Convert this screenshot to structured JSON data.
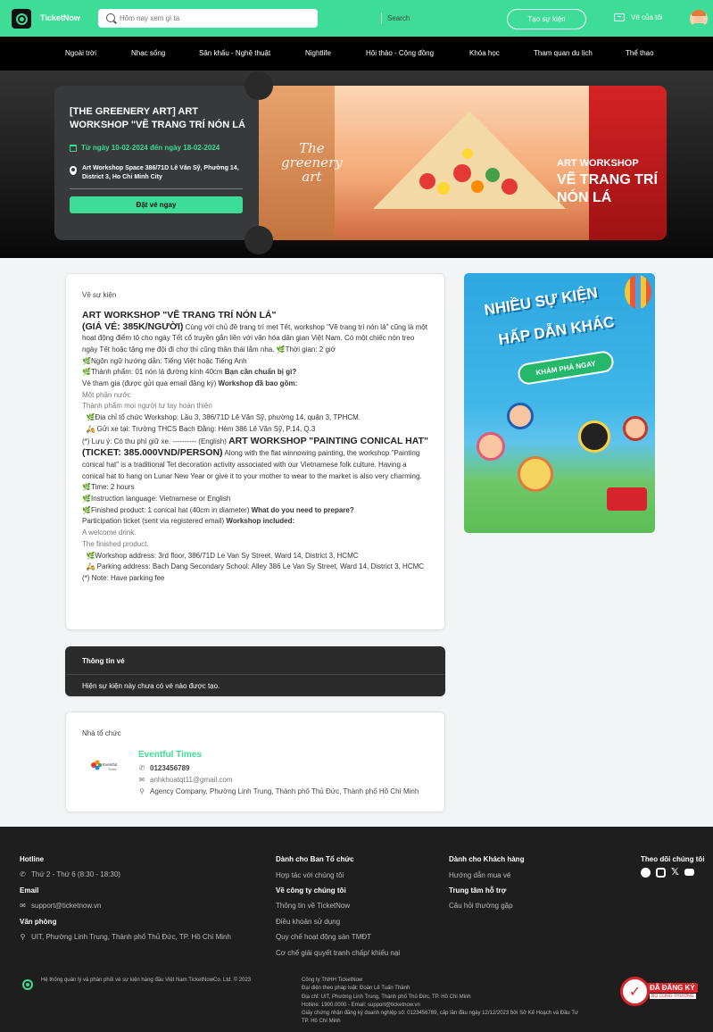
{
  "header": {
    "brand": "TicketNow",
    "search_placeholder": "Hôm nay xem gì ta",
    "search_button": "Search",
    "create_event": "Tạo sự kiện",
    "my_tickets": "Vé của tôi"
  },
  "nav": {
    "items": [
      "Ngoài trời",
      "Nhạc sống",
      "Sân khấu - Nghệ thuật",
      "Nightlife",
      "Hội thảo - Cộng đồng",
      "Khóa học",
      "Tham quan du lịch",
      "Thể thao"
    ]
  },
  "hero": {
    "title": "[THE GREENERY ART] ART WORKSHOP \"VẼ TRANG TRÍ NÓN LÁ",
    "date": "Từ ngày 10-02-2024 đến ngày 18-02-2024",
    "address": "Art Workshop Space 386/71D Lê Văn Sỹ, Phường 14, District 3, Ho Chi Minh City",
    "book_button": "Đặt vé ngay",
    "image_text": {
      "greenery_line1": "The",
      "greenery_line2": "greenery",
      "greenery_line3": "art",
      "aw_small": "ART WORKSHOP",
      "aw_big": "VẼ TRANG TRÍ NÓN LÁ"
    }
  },
  "about": {
    "label": "Về sự kiện",
    "vi_title": "ART WORKSHOP \"VẼ TRANG TRÍ NÓN LÁ\"",
    "vi_price": "(GIÁ VÉ: 385K/NGƯỜI)",
    "vi_intro": " Cùng với chủ đề trang trí mẹt Tết, workshop \"Vẽ trang trí nón lá\" cũng là một hoạt động điểm tô cho ngày Tết cổ truyền gắn liền với văn hóa dân gian Việt Nam. Có một chiếc nón treo ngày Tết hoặc tặng mẹ đội đi chợ thì cũng thần thái lắm nha. ",
    "vi_time": "Thời gian: 2 giờ",
    "vi_lang": "Ngôn ngữ hướng dẫn: Tiếng Việt hoặc Tiếng Anh",
    "vi_product": "Thành phẩm: 01 nón lá đường kính 40cm ",
    "vi_prepare": "Bạn cần chuẩn bị gì?",
    "vi_ticket": "Vé tham gia (được gửi qua email đăng ký) ",
    "vi_includes": "Workshop đã bao gồm:",
    "vi_drink": "Một phần nước",
    "vi_finished": "Thành phẩm mọi người tự tay hoàn thiện",
    "vi_address": "Địa chỉ tổ chức Workshop: Lầu 3, 386/71D Lê Văn Sỹ, phường 14, quận 3, TPHCM.",
    "vi_parking": "Gửi xe tại: Trường THCS Bạch Đằng: Hẻm 386 Lê Văn Sỹ, P.14, Q.3",
    "vi_note": "(*) Lưu ý: Có thu phí giữ xe. ---------- (English) ",
    "en_title": "ART WORKSHOP \"PAINTING CONICAL HAT\"",
    "en_price": "(TICKET: 385.000VND/PERSON)",
    "en_intro": " Along with the flat winnowing painting, the workshop \"Painting conical hat\" is a traditional Tet decoration activity associated with our Vietnamese folk culture. Having a conical hat to hang on Lunar New Year or give it to your mother to wear to the market is also very charming. ",
    "en_time": "Time: 2 hours",
    "en_lang": "Instruction language: Vietnamese or English",
    "en_product": "Finished product: 1 conical hat (40cm in diameter) ",
    "en_prepare": "What do you need to prepare?",
    "en_ticket": "Participation ticket (sent via registered email) ",
    "en_includes": "Workshop included:",
    "en_drink": "A welcome drink.",
    "en_finished": "The finished product.",
    "en_address": "Workshop address: 3rd floor, 386/71D Le Van Sy Street, Ward 14, District 3, HCMC",
    "en_parking": "Parking address: Bach Dang Secondary School: Alley 386 Le Van Sy Street, Ward 14, District 3, HCMC",
    "en_note": "(*) Note: Have parking fee"
  },
  "tickets": {
    "header": "Thông tin vé",
    "message": "Hiện sự kiện này chưa có vé nào được tạo."
  },
  "organizer": {
    "label": "Nhà tổ chức",
    "name": "Eventful Times",
    "phone": "0123456789",
    "email": "anhkhoatqt11@gmail.com",
    "address": "Agency Company, Phường Linh Trung, Thành phố Thủ Đức, Thành phố Hồ Chí Minh"
  },
  "ad": {
    "line1": "NHIỀU SỰ KIỆN",
    "line2": "HẤP DẪN KHÁC",
    "button": "KHÁM PHÁ NGAY"
  },
  "footer": {
    "hotline_label": "Hotline",
    "hotline_value": "Thứ 2 - Thứ 6 (8:30 - 18:30)",
    "email_label": "Email",
    "email_value": "support@ticketnow.vn",
    "office_label": "Văn phòng",
    "office_value": "UIT, Phường Linh Trung, Thành phố Thủ Đức, TP. Hồ Chí Minh",
    "organizer_head": "Dành cho Ban Tổ chức",
    "organizer_link": "Hợp tác với chúng tôi",
    "company_head": "Về công ty chúng tôi",
    "company_links": [
      "Thông tin về TicketNow",
      "Điều khoản sử dụng",
      "Quy chế hoạt động sàn TMĐT",
      "Cơ chế giải quyết tranh chấp/ khiếu nại"
    ],
    "customer_head": "Dành cho Khách hàng",
    "customer_link": "Hướng dẫn mua vé",
    "support_head": "Trung tâm hỗ trợ",
    "support_link": "Câu hỏi thường gặp",
    "follow": "Theo dõi chúng tôi",
    "tagline": "Hệ thống quản lý và phân phối vé sự kiện hàng đầu Việt Nam TicketNowCo. Ltd. © 2023",
    "company_lines": [
      "Công ty TNHH TicketNow",
      "Đại diện theo pháp luật: Đoàn Lê Tuấn Thành",
      "Địa chỉ: UIT, Phường Linh Trung, Thành phố Thủ Đức, TP. Hồ Chí Minh",
      "Hotline: 1900.0000 - Email: support@ticketnow.vn",
      "Giấy chứng nhận đăng ký doanh nghiệp số: 0123456789, cấp lần đầu ngày 12/12/2023 bởi Sở Kế Hoạch và Đầu Tư",
      "TP. Hồ Chí Minh"
    ],
    "badge_main": "ĐÃ ĐĂNG KÝ",
    "badge_sub": "BỘ CÔNG THƯƠNG"
  }
}
